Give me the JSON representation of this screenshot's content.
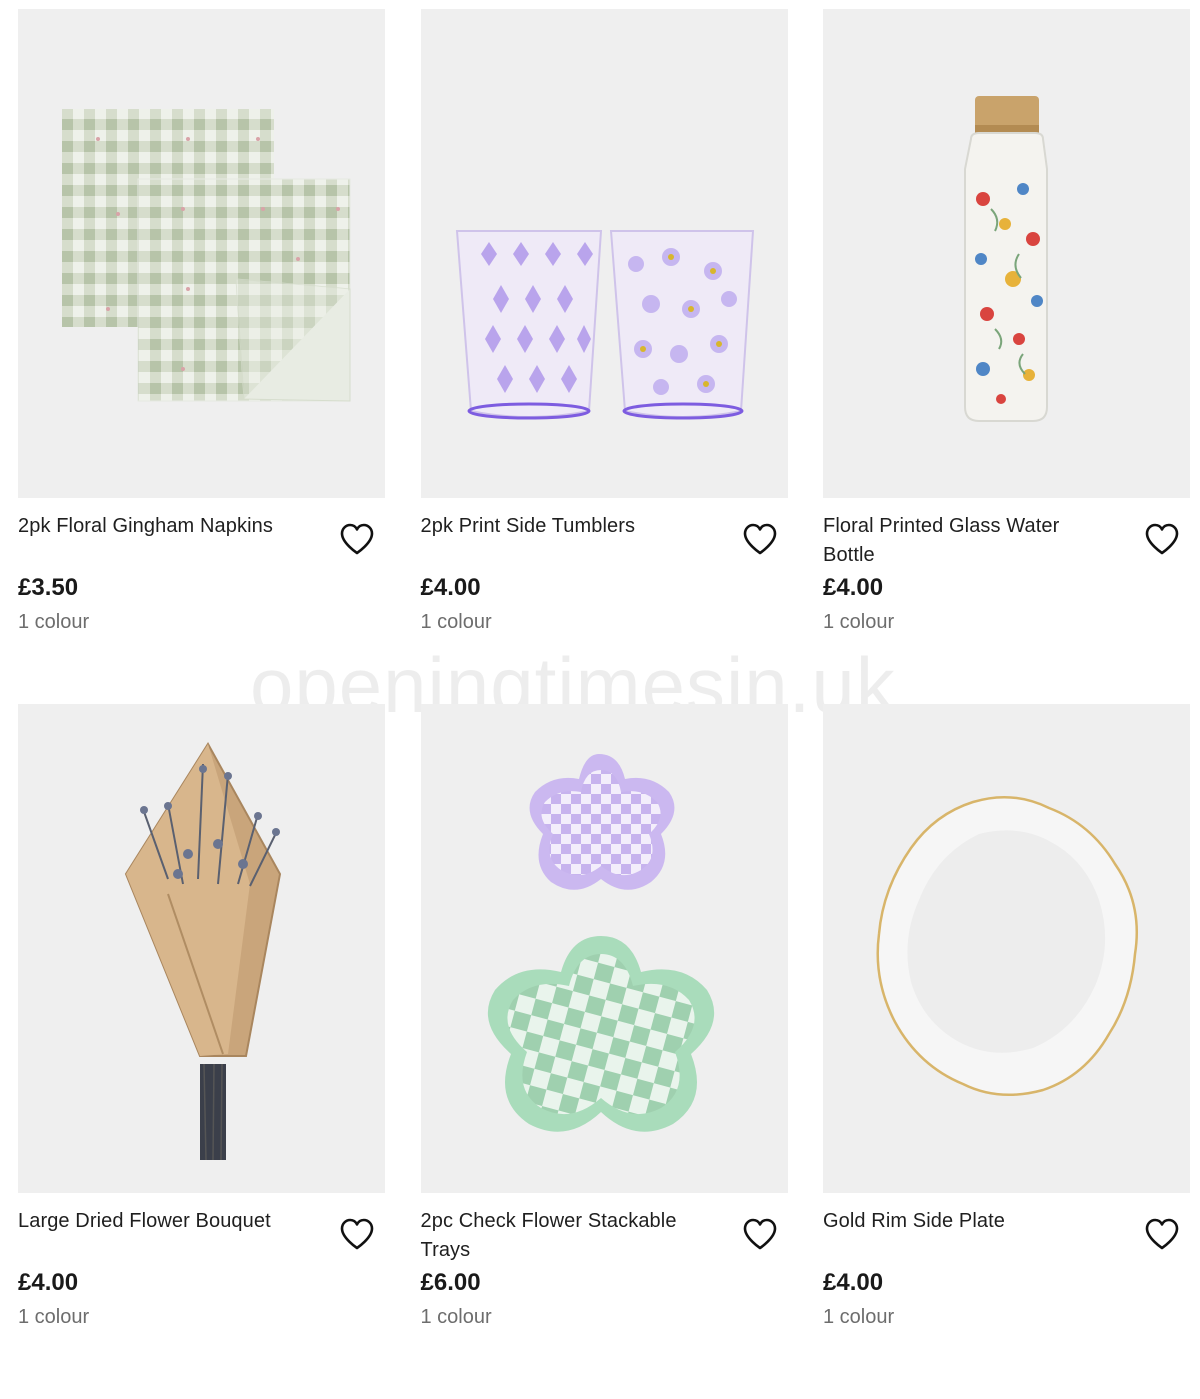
{
  "products": [
    {
      "name": "2pk Floral Gingham Napkins",
      "price": "£3.50",
      "colours": "1 colour",
      "image": "gingham-napkins-image"
    },
    {
      "name": "2pk Print Side Tumblers",
      "price": "£4.00",
      "colours": "1 colour",
      "image": "tumblers-image"
    },
    {
      "name": "Floral Printed Glass Water Bottle",
      "price": "£4.00",
      "colours": "1 colour",
      "image": "water-bottle-image"
    },
    {
      "name": "Large Dried Flower Bouquet",
      "price": "£4.00",
      "colours": "1 colour",
      "image": "flower-bouquet-image"
    },
    {
      "name": "2pc Check Flower Stackable Trays",
      "price": "£6.00",
      "colours": "1 colour",
      "image": "flower-trays-image"
    },
    {
      "name": "Gold Rim Side Plate",
      "price": "£4.00",
      "colours": "1 colour",
      "image": "side-plate-image"
    }
  ],
  "watermark": "openingtimesin.uk",
  "icons": {
    "favourite": "heart-outline-icon"
  },
  "colors": {
    "image_bg": "#efefef",
    "text": "#1a1a1a",
    "muted": "#6d6d6d"
  }
}
